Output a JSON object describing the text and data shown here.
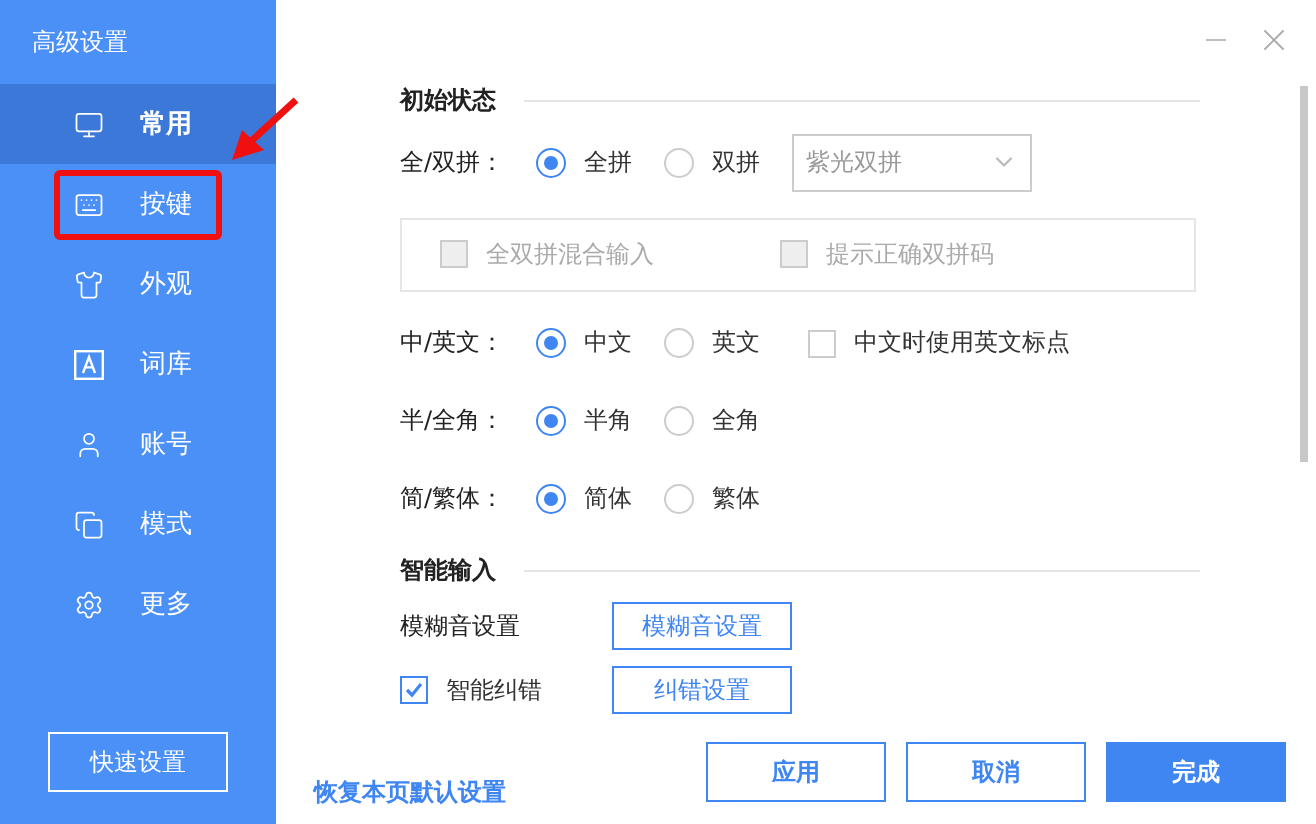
{
  "sidebar": {
    "title": "高级设置",
    "items": [
      {
        "label": "常用",
        "selected": true,
        "highlighted": false
      },
      {
        "label": "按键",
        "selected": false,
        "highlighted": true
      },
      {
        "label": "外观",
        "selected": false,
        "highlighted": false
      },
      {
        "label": "词库",
        "selected": false,
        "highlighted": false
      },
      {
        "label": "账号",
        "selected": false,
        "highlighted": false
      },
      {
        "label": "模式",
        "selected": false,
        "highlighted": false
      },
      {
        "label": "更多",
        "selected": false,
        "highlighted": false
      }
    ],
    "quick_button": "快速设置"
  },
  "sections": [
    {
      "title": "初始状态",
      "rows": [
        {
          "kind": "radio",
          "label": "全/双拼：",
          "options": [
            {
              "label": "全拼",
              "selected": true
            },
            {
              "label": "双拼",
              "selected": false
            }
          ],
          "dropdown": {
            "value": "紫光双拼",
            "disabled": true
          }
        },
        {
          "kind": "group",
          "disabled": true,
          "checkboxes": [
            {
              "label": "全双拼混合输入",
              "checked": false
            },
            {
              "label": "提示正确双拼码",
              "checked": false
            }
          ]
        },
        {
          "kind": "radio",
          "label": "中/英文：",
          "options": [
            {
              "label": "中文",
              "selected": true
            },
            {
              "label": "英文",
              "selected": false
            }
          ],
          "checkbox": {
            "label": "中文时使用英文标点",
            "checked": false
          }
        },
        {
          "kind": "radio",
          "label": "半/全角：",
          "options": [
            {
              "label": "半角",
              "selected": true
            },
            {
              "label": "全角",
              "selected": false
            }
          ]
        },
        {
          "kind": "radio",
          "label": "简/繁体：",
          "options": [
            {
              "label": "简体",
              "selected": true
            },
            {
              "label": "繁体",
              "selected": false
            }
          ]
        }
      ]
    },
    {
      "title": "智能输入",
      "rows": [
        {
          "kind": "button",
          "label": "模糊音设置",
          "button": "模糊音设置"
        },
        {
          "kind": "check_button",
          "label": "智能纠错",
          "checked": true,
          "button": "纠错设置"
        }
      ]
    }
  ],
  "footer": {
    "link": "恢复本页默认设置",
    "buttons": [
      {
        "label": "应用",
        "primary": false
      },
      {
        "label": "取消",
        "primary": false
      },
      {
        "label": "完成",
        "primary": true
      }
    ]
  }
}
